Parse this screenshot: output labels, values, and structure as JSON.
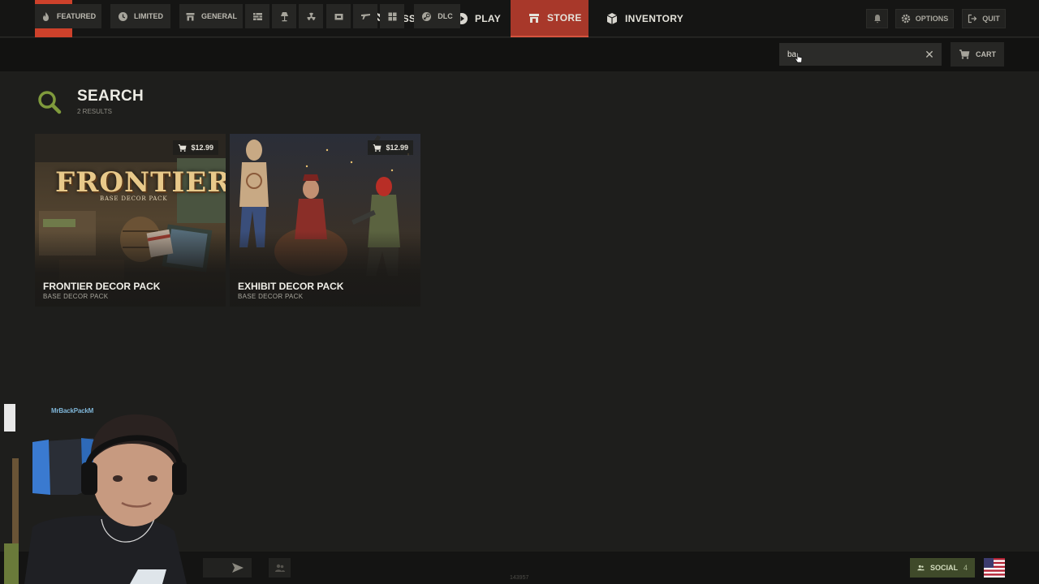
{
  "nav": {
    "items": [
      {
        "label": "SESSION",
        "icon": "syringe-icon"
      },
      {
        "label": "PLAY",
        "icon": "play-circle-icon"
      },
      {
        "label": "STORE",
        "icon": "storefront-icon",
        "active": true
      },
      {
        "label": "INVENTORY",
        "icon": "box-icon"
      }
    ],
    "options_label": "OPTIONS",
    "quit_label": "QUIT"
  },
  "categories": [
    {
      "label": "FEATURED",
      "icon": "flame-icon"
    },
    {
      "label": "LIMITED",
      "icon": "clock-icon"
    },
    {
      "label": "GENERAL",
      "icon": "storefront-icon"
    },
    {
      "label": "",
      "icon": "wall-icon"
    },
    {
      "label": "",
      "icon": "lamp-icon"
    },
    {
      "label": "",
      "icon": "radiation-icon"
    },
    {
      "label": "",
      "icon": "chest-icon"
    },
    {
      "label": "",
      "icon": "rifle-icon"
    },
    {
      "label": "",
      "icon": "grid-icon"
    },
    {
      "label": "DLC",
      "icon": "steam-icon"
    }
  ],
  "search": {
    "value": "ba",
    "cart_label": "CART"
  },
  "results": {
    "title": "SEARCH",
    "count": "2 RESULTS",
    "items": [
      {
        "name": "FRONTIER DECOR PACK",
        "subtitle": "BASE DECOR PACK",
        "price": "$12.99",
        "art_title": "FRONTIER",
        "art_subtitle": "BASE DECOR PACK"
      },
      {
        "name": "EXHIBIT DECOR PACK",
        "subtitle": "BASE DECOR PACK",
        "price": "$12.99"
      }
    ]
  },
  "webcam": {
    "tag": "MrBackPackM"
  },
  "bottom": {
    "build": "143957",
    "social_label": "SOCIAL",
    "social_count": "4"
  },
  "colors": {
    "accent": "#a8382a",
    "logo": "#cd412b",
    "social": "#3f4a2a",
    "search_icon": "#7f9a3c"
  }
}
